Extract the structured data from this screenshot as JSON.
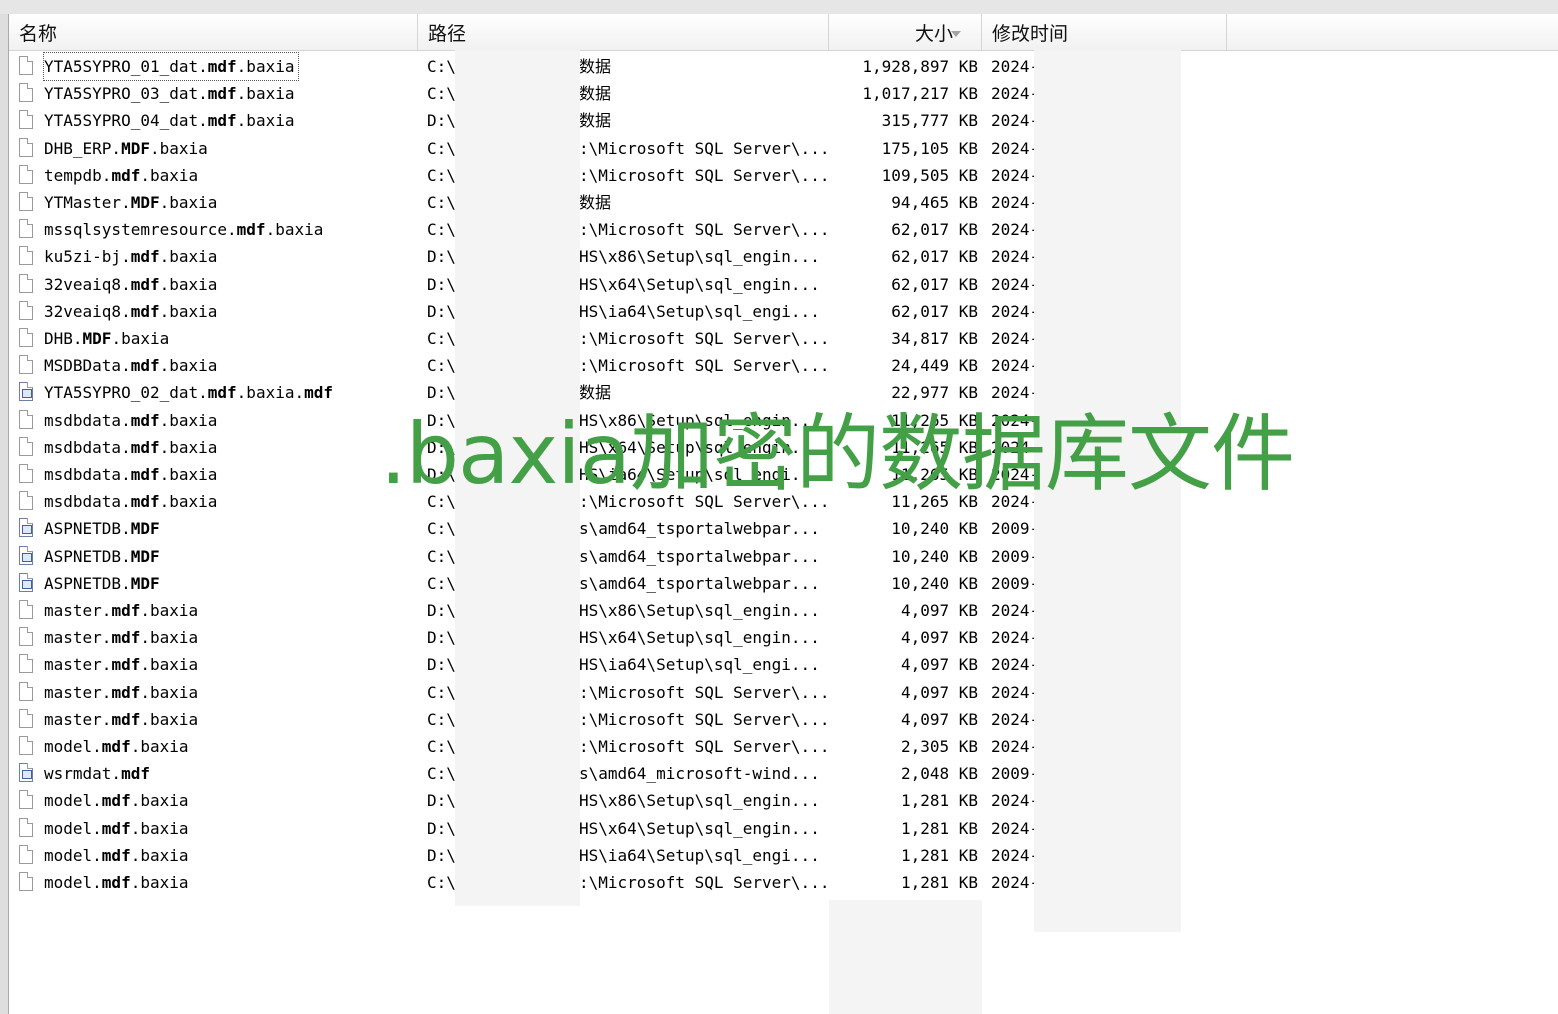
{
  "columns": {
    "name": "名称",
    "path": "路径",
    "size": "大小",
    "modified": "修改时间"
  },
  "rows": [
    {
      "prefix": "YTA5SYPRO_01_dat.",
      "bold": "mdf",
      "suffix": ".baxia",
      "drive": "C:\\",
      "path": "数据",
      "size": "1,928,897 KB",
      "date": "2024-",
      "icon": "file-icon"
    },
    {
      "prefix": "YTA5SYPRO_03_dat.",
      "bold": "mdf",
      "suffix": ".baxia",
      "drive": "C:\\",
      "path": "数据",
      "size": "1,017,217 KB",
      "date": "2024-",
      "icon": "file-icon"
    },
    {
      "prefix": "YTA5SYPRO_04_dat.",
      "bold": "mdf",
      "suffix": ".baxia",
      "drive": "D:\\",
      "path": "数据",
      "size": "315,777 KB",
      "date": "2024-",
      "icon": "file-icon"
    },
    {
      "prefix": "DHB_ERP.",
      "bold": "MDF",
      "suffix": ".baxia",
      "drive": "C:\\",
      "path": ":\\Microsoft SQL Server\\...",
      "size": "175,105 KB",
      "date": "2024-",
      "icon": "file-icon"
    },
    {
      "prefix": "tempdb.",
      "bold": "mdf",
      "suffix": ".baxia",
      "drive": "C:\\",
      "path": ":\\Microsoft SQL Server\\...",
      "size": "109,505 KB",
      "date": "2024-",
      "icon": "file-icon"
    },
    {
      "prefix": "YTMaster.",
      "bold": "MDF",
      "suffix": ".baxia",
      "drive": "C:\\",
      "path": "数据",
      "size": "94,465 KB",
      "date": "2024-",
      "icon": "file-icon"
    },
    {
      "prefix": "mssqlsystemresource.",
      "bold": "mdf",
      "suffix": ".baxia",
      "drive": "C:\\",
      "path": ":\\Microsoft SQL Server\\...",
      "size": "62,017 KB",
      "date": "2024-",
      "icon": "file-icon"
    },
    {
      "prefix": "ku5zi-bj.",
      "bold": "mdf",
      "suffix": ".baxia",
      "drive": "D:\\",
      "path": "HS\\x86\\Setup\\sql_engin...",
      "size": "62,017 KB",
      "date": "2024-",
      "icon": "file-icon"
    },
    {
      "prefix": "32veaiq8.",
      "bold": "mdf",
      "suffix": ".baxia",
      "drive": "D:\\",
      "path": "HS\\x64\\Setup\\sql_engin...",
      "size": "62,017 KB",
      "date": "2024-",
      "icon": "file-icon"
    },
    {
      "prefix": "32veaiq8.",
      "bold": "mdf",
      "suffix": ".baxia",
      "drive": "D:\\",
      "path": "HS\\ia64\\Setup\\sql_engi...",
      "size": "62,017 KB",
      "date": "2024-",
      "icon": "file-icon"
    },
    {
      "prefix": "DHB.",
      "bold": "MDF",
      "suffix": ".baxia",
      "drive": "C:\\",
      "path": ":\\Microsoft SQL Server\\...",
      "size": "34,817 KB",
      "date": "2024-",
      "icon": "file-icon"
    },
    {
      "prefix": "MSDBData.",
      "bold": "mdf",
      "suffix": ".baxia",
      "drive": "C:\\",
      "path": ":\\Microsoft SQL Server\\...",
      "size": "24,449 KB",
      "date": "2024-",
      "icon": "file-icon"
    },
    {
      "prefix": "YTA5SYPRO_02_dat.",
      "bold": "mdf",
      "suffix": ".baxia.",
      "bold2": "mdf",
      "drive": "D:\\",
      "path": "数据",
      "size": "22,977 KB",
      "date": "2024-",
      "icon": "database-file-icon"
    },
    {
      "prefix": "msdbdata.",
      "bold": "mdf",
      "suffix": ".baxia",
      "drive": "D:\\",
      "path": "HS\\x86\\Setup\\sql_engin...",
      "size": "11,265 KB",
      "date": "2024-",
      "icon": "file-icon"
    },
    {
      "prefix": "msdbdata.",
      "bold": "mdf",
      "suffix": ".baxia",
      "drive": "D:\\",
      "path": "HS\\x64\\Setup\\sql_engin...",
      "size": "11,265 KB",
      "date": "2024-",
      "icon": "file-icon"
    },
    {
      "prefix": "msdbdata.",
      "bold": "mdf",
      "suffix": ".baxia",
      "drive": "D:\\",
      "path": "HS\\ia64\\Setup\\sql_engi...",
      "size": "11,265 KB",
      "date": "2024-",
      "icon": "file-icon"
    },
    {
      "prefix": "msdbdata.",
      "bold": "mdf",
      "suffix": ".baxia",
      "drive": "C:\\",
      "path": ":\\Microsoft SQL Server\\...",
      "size": "11,265 KB",
      "date": "2024-",
      "icon": "file-icon"
    },
    {
      "prefix": "ASPNETDB.",
      "bold": "MDF",
      "suffix": "",
      "drive": "C:\\",
      "path": "s\\amd64_tsportalwebpar...",
      "size": "10,240 KB",
      "date": "2009-",
      "icon": "database-file-icon"
    },
    {
      "prefix": "ASPNETDB.",
      "bold": "MDF",
      "suffix": "",
      "drive": "C:\\",
      "path": "s\\amd64_tsportalwebpar...",
      "size": "10,240 KB",
      "date": "2009-",
      "icon": "database-file-icon"
    },
    {
      "prefix": "ASPNETDB.",
      "bold": "MDF",
      "suffix": "",
      "drive": "C:\\",
      "path": "s\\amd64_tsportalwebpar...",
      "size": "10,240 KB",
      "date": "2009-",
      "icon": "database-file-icon"
    },
    {
      "prefix": "master.",
      "bold": "mdf",
      "suffix": ".baxia",
      "drive": "D:\\",
      "path": "HS\\x86\\Setup\\sql_engin...",
      "size": "4,097 KB",
      "date": "2024-",
      "icon": "file-icon"
    },
    {
      "prefix": "master.",
      "bold": "mdf",
      "suffix": ".baxia",
      "drive": "D:\\",
      "path": "HS\\x64\\Setup\\sql_engin...",
      "size": "4,097 KB",
      "date": "2024-",
      "icon": "file-icon"
    },
    {
      "prefix": "master.",
      "bold": "mdf",
      "suffix": ".baxia",
      "drive": "D:\\",
      "path": "HS\\ia64\\Setup\\sql_engi...",
      "size": "4,097 KB",
      "date": "2024-",
      "icon": "file-icon"
    },
    {
      "prefix": "master.",
      "bold": "mdf",
      "suffix": ".baxia",
      "drive": "C:\\",
      "path": ":\\Microsoft SQL Server\\...",
      "size": "4,097 KB",
      "date": "2024-",
      "icon": "file-icon"
    },
    {
      "prefix": "master.",
      "bold": "mdf",
      "suffix": ".baxia",
      "drive": "C:\\",
      "path": ":\\Microsoft SQL Server\\...",
      "size": "4,097 KB",
      "date": "2024-",
      "icon": "file-icon"
    },
    {
      "prefix": "model.",
      "bold": "mdf",
      "suffix": ".baxia",
      "drive": "C:\\",
      "path": ":\\Microsoft SQL Server\\...",
      "size": "2,305 KB",
      "date": "2024-",
      "icon": "file-icon"
    },
    {
      "prefix": "wsrmdat.",
      "bold": "mdf",
      "suffix": "",
      "drive": "C:\\",
      "path": "s\\amd64_microsoft-wind...",
      "size": "2,048 KB",
      "date": "2009-",
      "icon": "database-file-icon"
    },
    {
      "prefix": "model.",
      "bold": "mdf",
      "suffix": ".baxia",
      "drive": "D:\\",
      "path": "HS\\x86\\Setup\\sql_engin...",
      "size": "1,281 KB",
      "date": "2024-",
      "icon": "file-icon"
    },
    {
      "prefix": "model.",
      "bold": "mdf",
      "suffix": ".baxia",
      "drive": "D:\\",
      "path": "HS\\x64\\Setup\\sql_engin...",
      "size": "1,281 KB",
      "date": "2024-",
      "icon": "file-icon"
    },
    {
      "prefix": "model.",
      "bold": "mdf",
      "suffix": ".baxia",
      "drive": "D:\\",
      "path": "HS\\ia64\\Setup\\sql_engi...",
      "size": "1,281 KB",
      "date": "2024-",
      "icon": "file-icon"
    },
    {
      "prefix": "model.",
      "bold": "mdf",
      "suffix": ".baxia",
      "drive": "C:\\",
      "path": ":\\Microsoft SQL Server\\...",
      "size": "1,281 KB",
      "date": "2024-",
      "icon": "file-icon"
    }
  ],
  "watermark": ".baxia加密的数据库文件",
  "colors": {
    "watermark": "#43a047",
    "header_bg": "#f4f4f4",
    "sort_arrow": "#a4a4a4"
  }
}
